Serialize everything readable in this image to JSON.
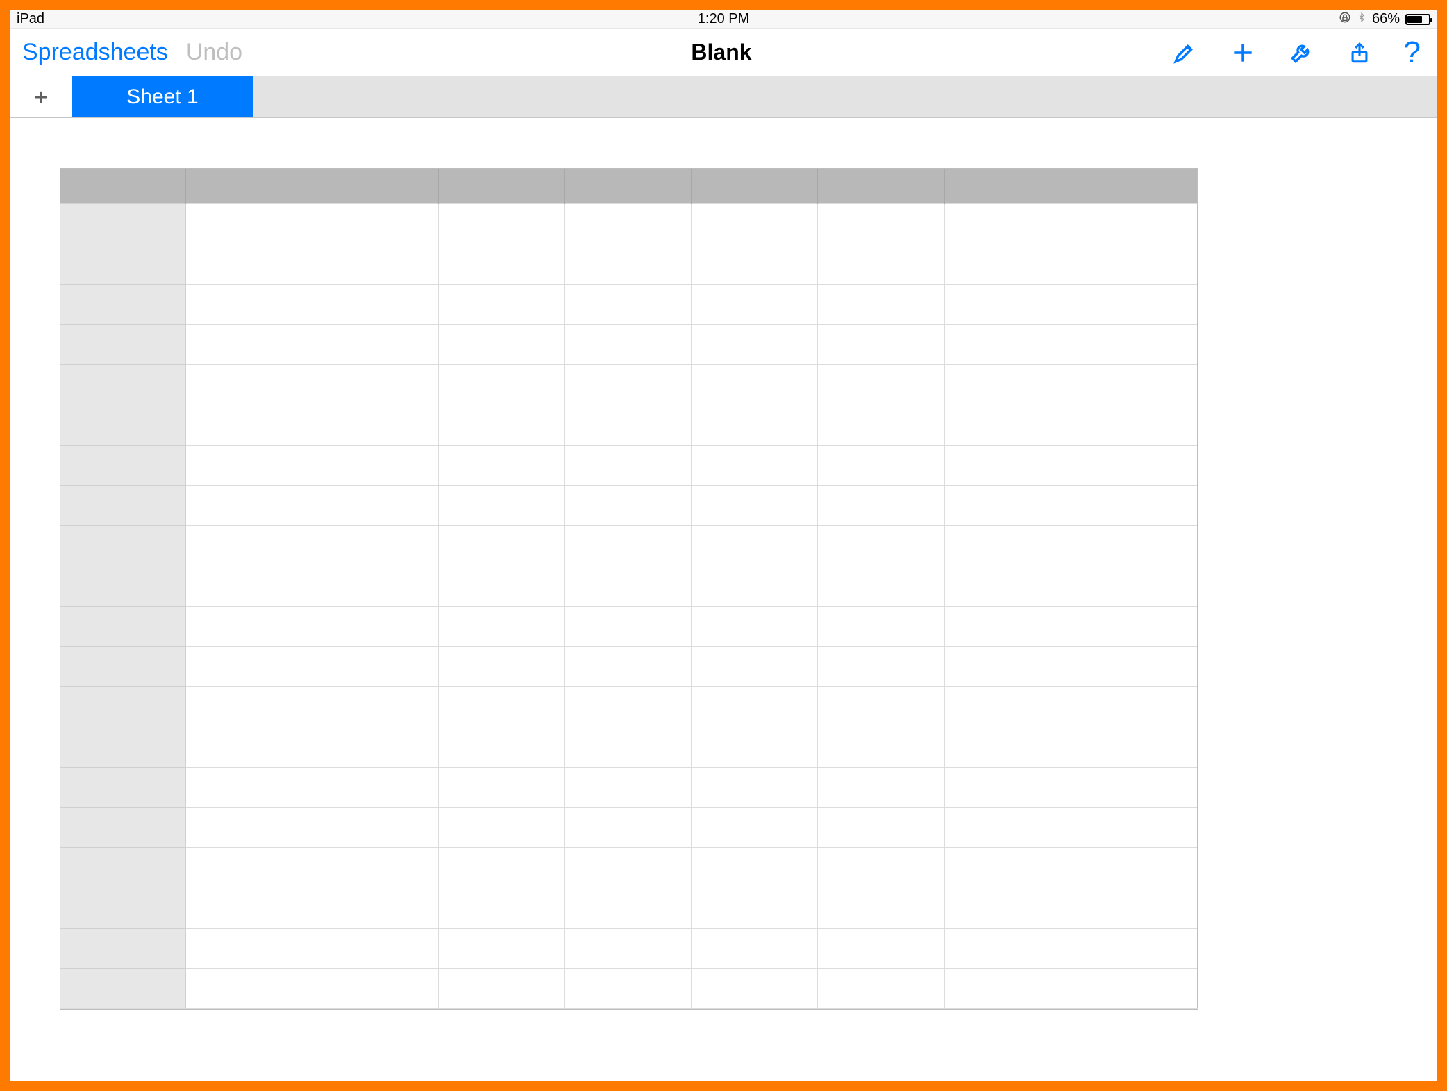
{
  "statusbar": {
    "device": "iPad",
    "time": "1:20 PM",
    "battery_percent": "66%"
  },
  "toolbar": {
    "back_label": "Spreadsheets",
    "undo_label": "Undo",
    "title": "Blank"
  },
  "tabs": {
    "active_label": "Sheet 1"
  },
  "grid": {
    "data_columns": 8,
    "rows": 20
  },
  "colors": {
    "accent": "#007aff",
    "frame": "#ff7a00"
  }
}
